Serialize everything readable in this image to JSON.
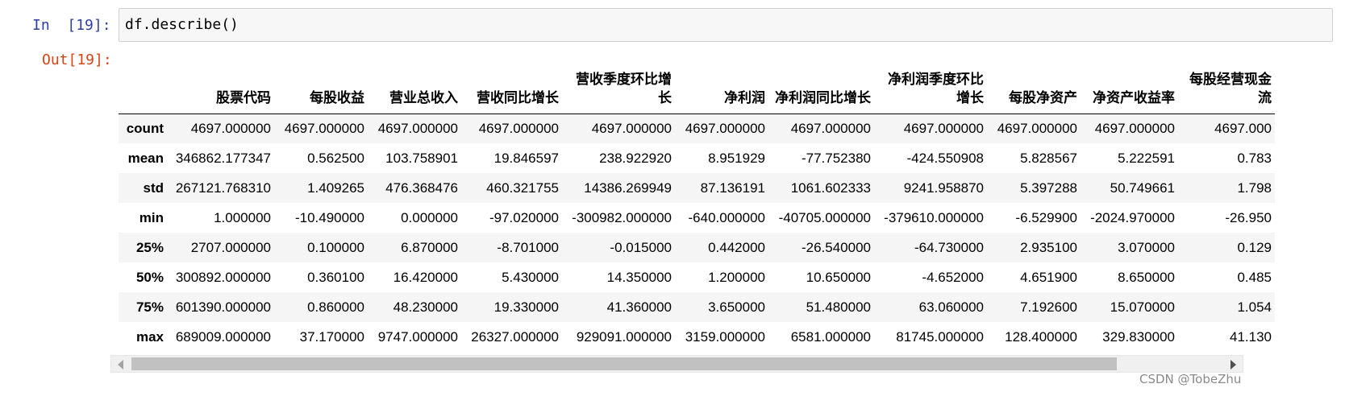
{
  "input_cell": {
    "prompt_in": "In",
    "prompt_number": "[19]:",
    "code": "df.describe()"
  },
  "output_cell": {
    "prompt": "Out[19]:"
  },
  "table": {
    "columns": [
      "股票代码",
      "每股收益",
      "营业总收入",
      "营收同比增长",
      "营收季度环比增长",
      "净利润",
      "净利润同比增长",
      "净利润季度环比增长",
      "每股净资产",
      "净资产收益率",
      "每股经营现金流"
    ],
    "rows": [
      {
        "label": "count",
        "values": [
          "4697.000000",
          "4697.000000",
          "4697.000000",
          "4697.000000",
          "4697.000000",
          "4697.000000",
          "4697.000000",
          "4697.000000",
          "4697.000000",
          "4697.000000",
          "4697.000"
        ]
      },
      {
        "label": "mean",
        "values": [
          "346862.177347",
          "0.562500",
          "103.758901",
          "19.846597",
          "238.922920",
          "8.951929",
          "-77.752380",
          "-424.550908",
          "5.828567",
          "5.222591",
          "0.783"
        ]
      },
      {
        "label": "std",
        "values": [
          "267121.768310",
          "1.409265",
          "476.368476",
          "460.321755",
          "14386.269949",
          "87.136191",
          "1061.602333",
          "9241.958870",
          "5.397288",
          "50.749661",
          "1.798"
        ]
      },
      {
        "label": "min",
        "values": [
          "1.000000",
          "-10.490000",
          "0.000000",
          "-97.020000",
          "-300982.000000",
          "-640.000000",
          "-40705.000000",
          "-379610.000000",
          "-6.529900",
          "-2024.970000",
          "-26.950"
        ]
      },
      {
        "label": "25%",
        "values": [
          "2707.000000",
          "0.100000",
          "6.870000",
          "-8.701000",
          "-0.015000",
          "0.442000",
          "-26.540000",
          "-64.730000",
          "2.935100",
          "3.070000",
          "0.129"
        ]
      },
      {
        "label": "50%",
        "values": [
          "300892.000000",
          "0.360100",
          "16.420000",
          "5.430000",
          "14.350000",
          "1.200000",
          "10.650000",
          "-4.652000",
          "4.651900",
          "8.650000",
          "0.485"
        ]
      },
      {
        "label": "75%",
        "values": [
          "601390.000000",
          "0.860000",
          "48.230000",
          "19.330000",
          "41.360000",
          "3.650000",
          "51.480000",
          "63.060000",
          "7.192600",
          "15.070000",
          "1.054"
        ]
      },
      {
        "label": "max",
        "values": [
          "689009.000000",
          "37.170000",
          "9747.000000",
          "26327.000000",
          "929091.000000",
          "3159.000000",
          "6581.000000",
          "81745.000000",
          "128.400000",
          "329.830000",
          "41.130"
        ]
      }
    ]
  },
  "watermark": "CSDN @TobeZhu",
  "colors": {
    "in_prompt": "#303f9f",
    "out_prompt": "#d84315",
    "input_bg": "#f7f7f7",
    "row_stripe": "#f5f5f5",
    "scroll_thumb": "#c1c1c1"
  }
}
